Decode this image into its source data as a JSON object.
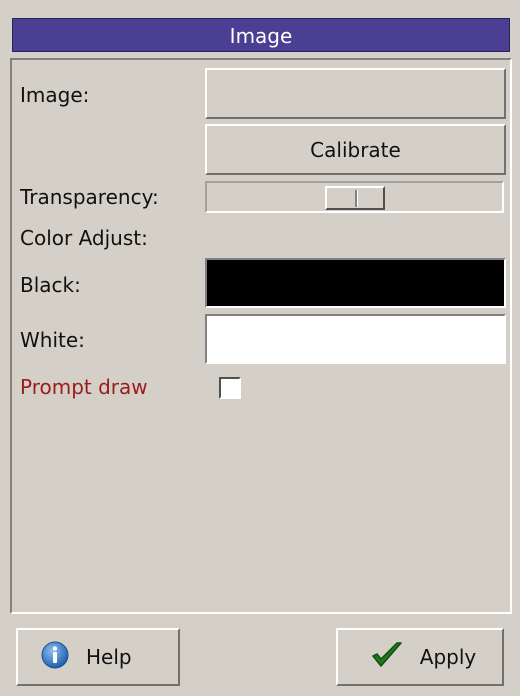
{
  "window": {
    "title": "Image"
  },
  "form": {
    "image_label": "Image:",
    "image_value": "",
    "calibrate_label": "Calibrate",
    "transparency_label": "Transparency:",
    "transparency_level": 0.5,
    "color_adjust_label": "Color Adjust:",
    "black_label": "Black:",
    "black_color": "#000000",
    "white_label": "White:",
    "white_color": "#ffffff",
    "prompt_draw_label": "Prompt draw",
    "prompt_draw_checked": false
  },
  "footer": {
    "help_label": "Help",
    "apply_label": "Apply",
    "help_icon": "info-icon",
    "apply_icon": "checkmark-icon"
  },
  "colors": {
    "title_bar": "#4a3f93",
    "prompt_text": "#9b1c1c"
  }
}
